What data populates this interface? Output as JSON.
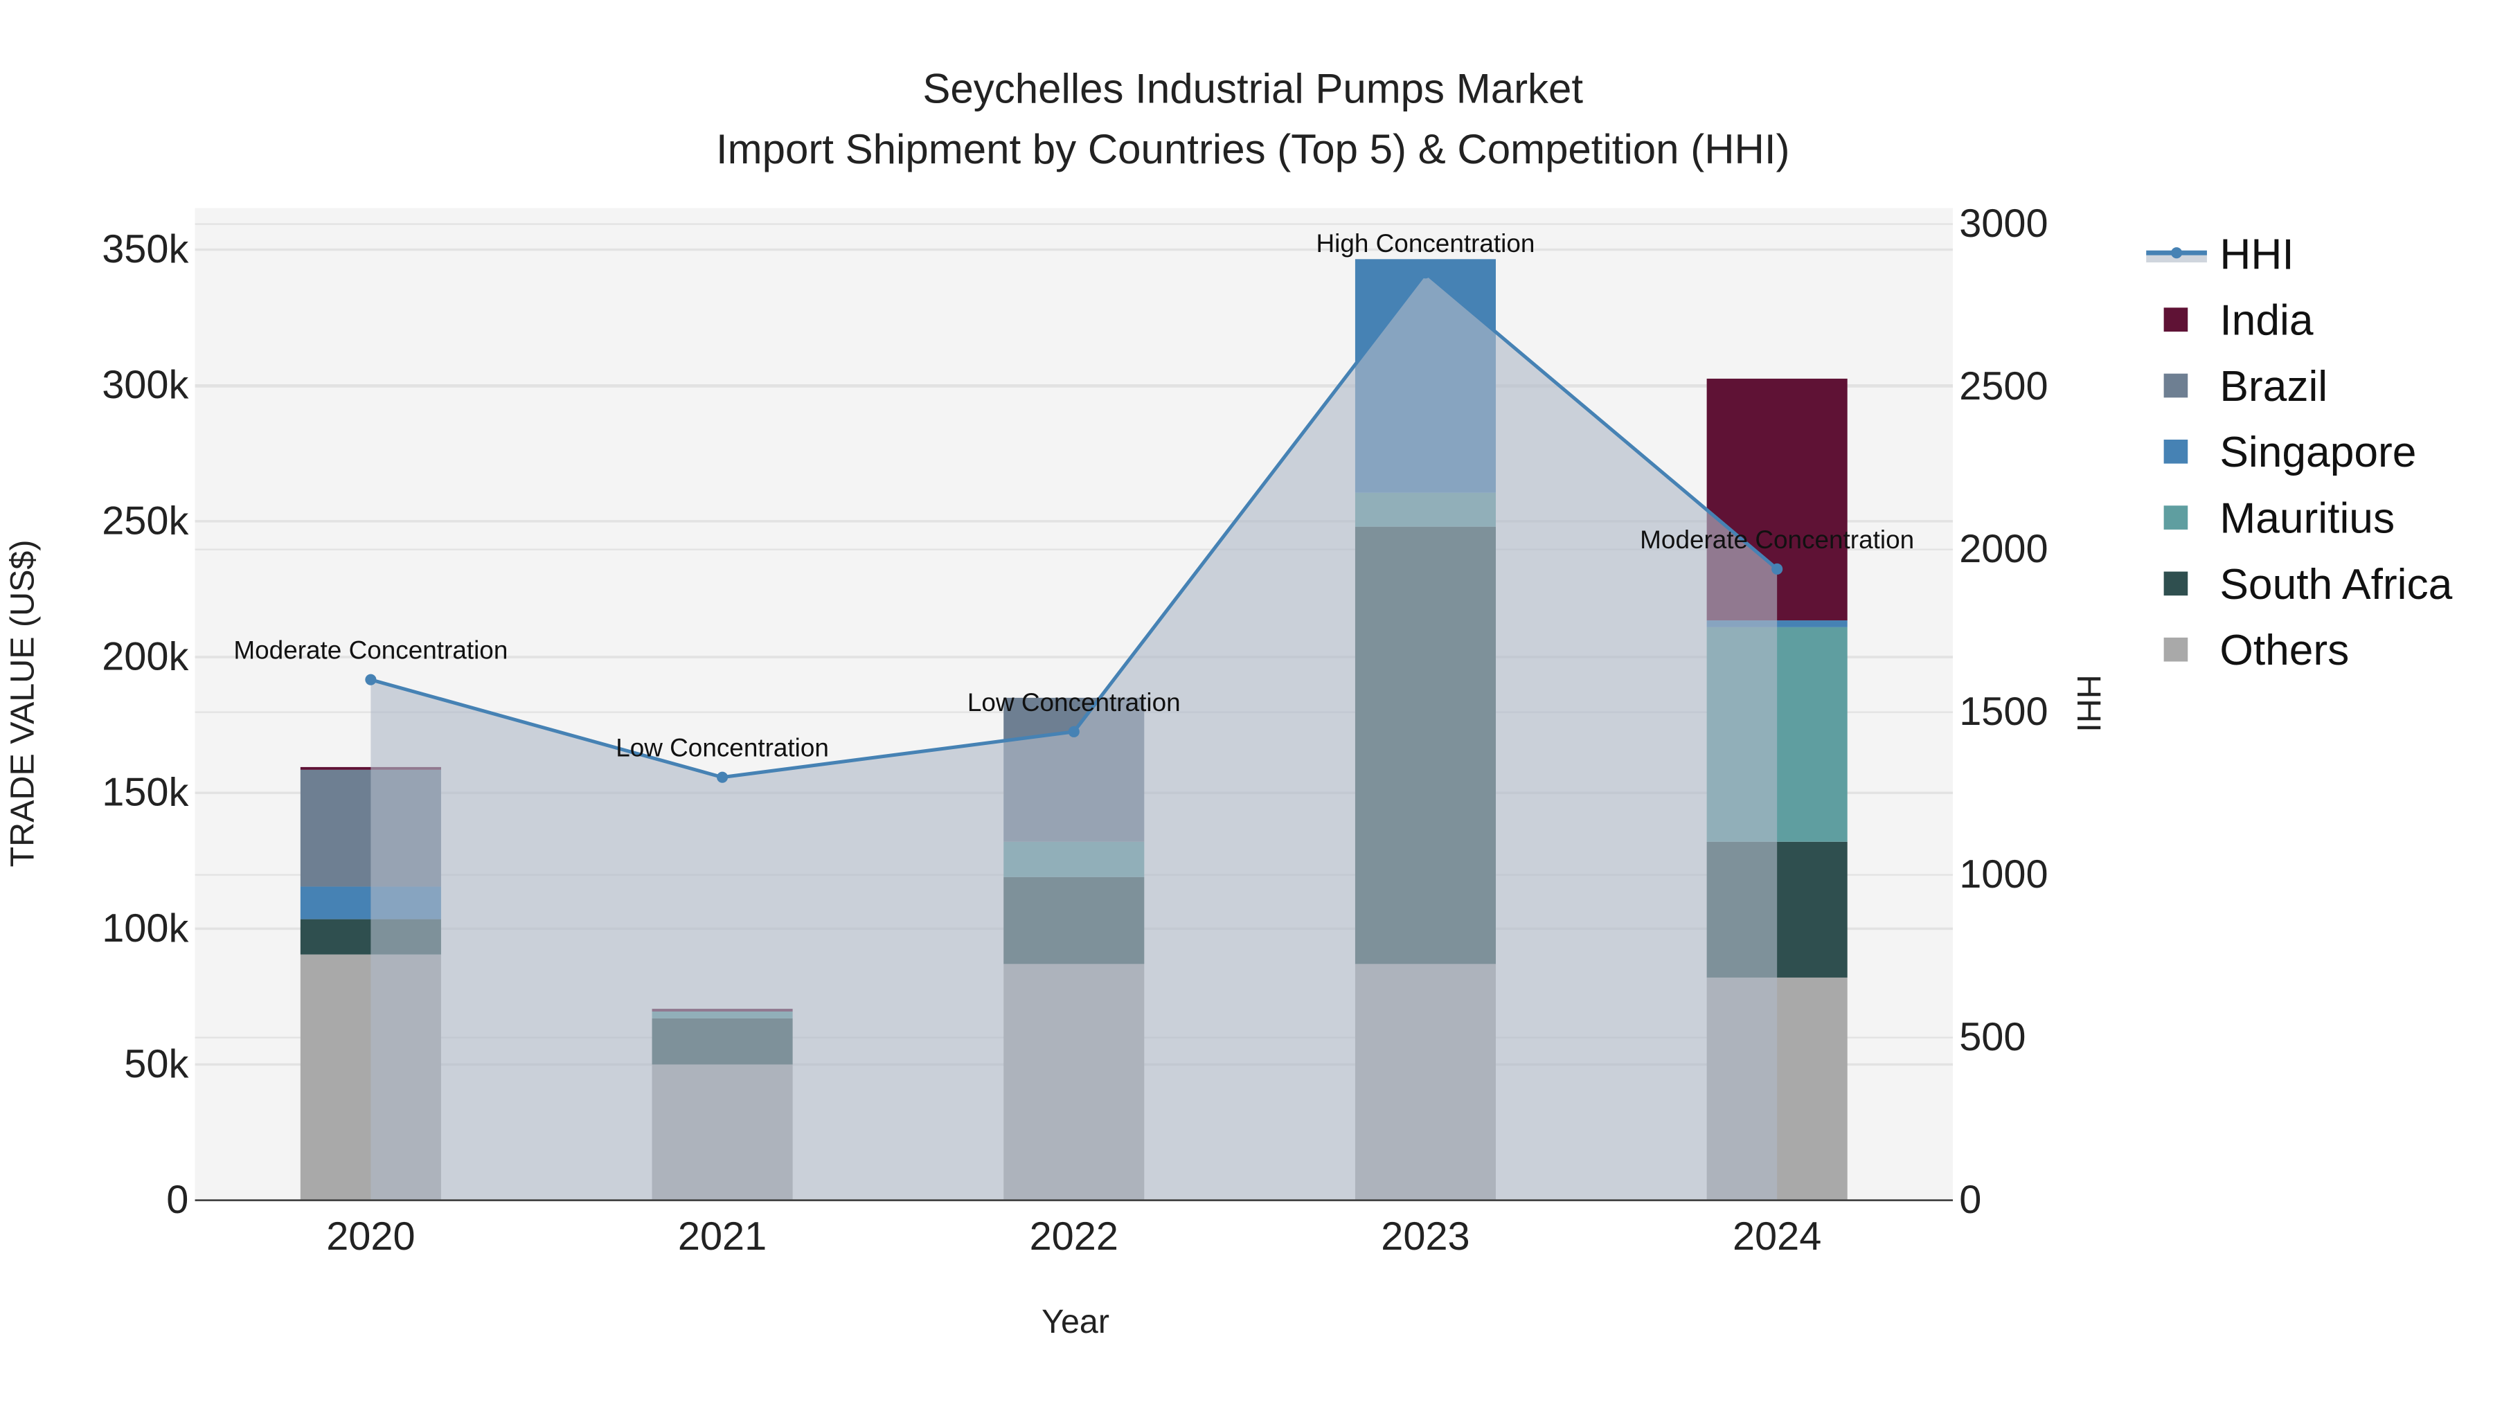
{
  "chart_data": {
    "type": "bar",
    "title": "Seychelles Industrial Pumps Market",
    "subtitle": "Import Shipment by Countries (Top 5) & Competition (HHI)",
    "xlabel": "Year",
    "ylabel": "TRADE VALUE (US$)",
    "y2label": "HHI",
    "categories": [
      "2020",
      "2021",
      "2022",
      "2023",
      "2024"
    ],
    "ylim": [
      0,
      365000
    ],
    "y2lim": [
      0,
      3050
    ],
    "yticks": [
      0,
      50000,
      100000,
      150000,
      200000,
      250000,
      300000,
      350000
    ],
    "yticklabels": [
      "0",
      "50k",
      "100k",
      "150k",
      "200k",
      "250k",
      "300k",
      "350k"
    ],
    "y2ticks": [
      0,
      500,
      1000,
      1500,
      2000,
      2500,
      3000
    ],
    "y2ticklabels": [
      "0",
      "500",
      "1000",
      "1500",
      "2000",
      "2500",
      "3000"
    ],
    "stacking": "stacked",
    "legend_position": "right",
    "grid": true,
    "series": [
      {
        "name": "Others",
        "color": "#a9a9a9",
        "values": [
          90500,
          50000,
          87000,
          87000,
          82000
        ]
      },
      {
        "name": "South Africa",
        "color": "#2f4f4f",
        "values": [
          13000,
          17000,
          32000,
          161000,
          50000
        ]
      },
      {
        "name": "Mauritius",
        "color": "#5f9ea0",
        "values": [
          0,
          2500,
          13000,
          12500,
          79000
        ]
      },
      {
        "name": "Singapore",
        "color": "#4682b4",
        "values": [
          12000,
          0,
          0,
          86000,
          2500
        ]
      },
      {
        "name": "Brazil",
        "color": "#6e7f92",
        "values": [
          43000,
          0,
          53000,
          0,
          0
        ]
      },
      {
        "name": "India",
        "color": "#5f1235",
        "values": [
          1000,
          1000,
          0,
          0,
          89000
        ]
      }
    ],
    "legend_order": [
      "HHI",
      "India",
      "Brazil",
      "Singapore",
      "Mauritius",
      "South Africa",
      "Others"
    ],
    "hhi": {
      "name": "HHI",
      "color": "#4682b4",
      "values": [
        1600,
        1300,
        1440,
        2850,
        1940
      ],
      "annotations": [
        "Moderate Concentration",
        "Low Concentration",
        "Low Concentration",
        "High Concentration",
        "Moderate Concentration"
      ]
    }
  }
}
